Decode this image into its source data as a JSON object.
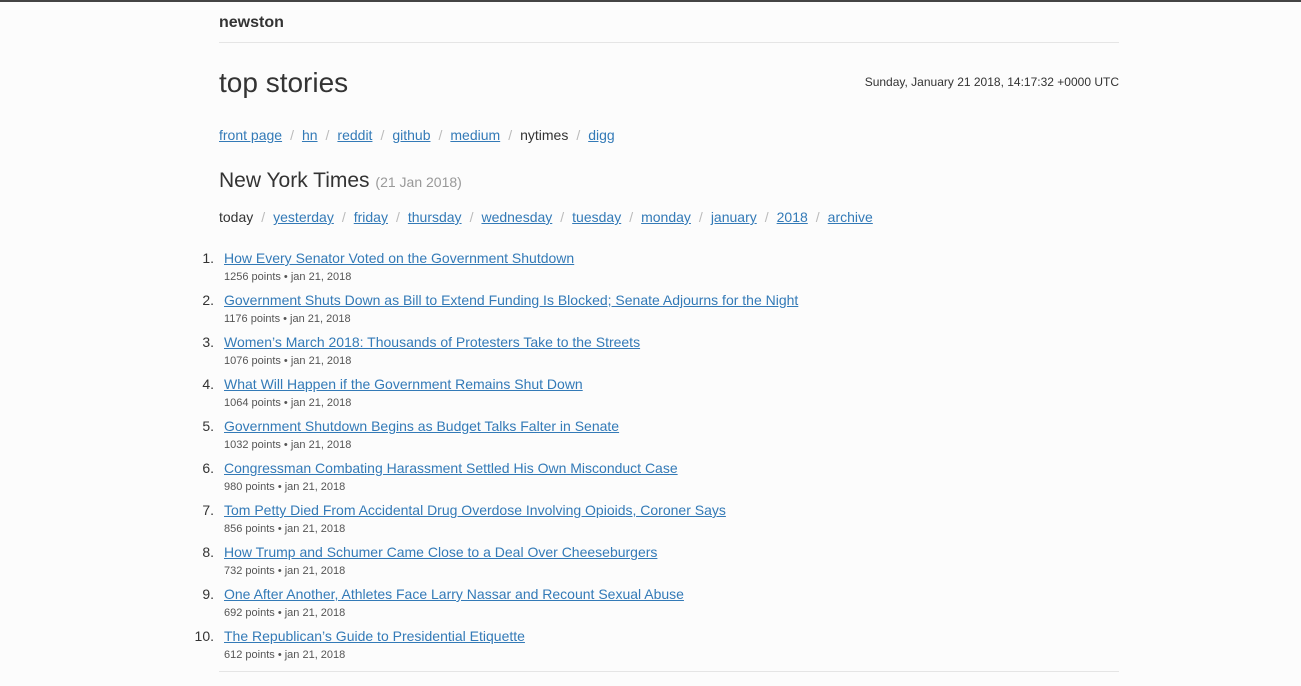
{
  "brand": "newston",
  "page_title": "top stories",
  "timestamp": "Sunday, January 21 2018, 14:17:32 +0000 UTC",
  "nav": [
    {
      "label": "front page",
      "current": false
    },
    {
      "label": "hn",
      "current": false
    },
    {
      "label": "reddit",
      "current": false
    },
    {
      "label": "github",
      "current": false
    },
    {
      "label": "medium",
      "current": false
    },
    {
      "label": "nytimes",
      "current": true
    },
    {
      "label": "digg",
      "current": false
    }
  ],
  "section": {
    "title": "New York Times",
    "date": "(21 Jan 2018)"
  },
  "date_nav": [
    {
      "label": "today",
      "current": true
    },
    {
      "label": "yesterday",
      "current": false
    },
    {
      "label": "friday",
      "current": false
    },
    {
      "label": "thursday",
      "current": false
    },
    {
      "label": "wednesday",
      "current": false
    },
    {
      "label": "tuesday",
      "current": false
    },
    {
      "label": "monday",
      "current": false
    },
    {
      "label": "january",
      "current": false
    },
    {
      "label": "2018",
      "current": false
    },
    {
      "label": "archive",
      "current": false
    }
  ],
  "separator": "/",
  "stories": [
    {
      "num": "1.",
      "title": "How Every Senator Voted on the Government Shutdown",
      "meta": "1256 points • jan 21, 2018"
    },
    {
      "num": "2.",
      "title": "Government Shuts Down as Bill to Extend Funding Is Blocked; Senate Adjourns for the Night",
      "meta": "1176 points • jan 21, 2018"
    },
    {
      "num": "3.",
      "title": "Women’s March 2018: Thousands of Protesters Take to the Streets",
      "meta": "1076 points • jan 21, 2018"
    },
    {
      "num": "4.",
      "title": "What Will Happen if the Government Remains Shut Down",
      "meta": "1064 points • jan 21, 2018"
    },
    {
      "num": "5.",
      "title": "Government Shutdown Begins as Budget Talks Falter in Senate",
      "meta": "1032 points • jan 21, 2018"
    },
    {
      "num": "6.",
      "title": "Congressman Combating Harassment Settled His Own Misconduct Case",
      "meta": "980 points • jan 21, 2018"
    },
    {
      "num": "7.",
      "title": "Tom Petty Died From Accidental Drug Overdose Involving Opioids, Coroner Says",
      "meta": "856 points • jan 21, 2018"
    },
    {
      "num": "8.",
      "title": "How Trump and Schumer Came Close to a Deal Over Cheeseburgers",
      "meta": "732 points • jan 21, 2018"
    },
    {
      "num": "9.",
      "title": "One After Another, Athletes Face Larry Nassar and Recount Sexual Abuse",
      "meta": "692 points • jan 21, 2018"
    },
    {
      "num": "10.",
      "title": "The Republican’s Guide to Presidential Etiquette",
      "meta": "612 points • jan 21, 2018"
    }
  ]
}
